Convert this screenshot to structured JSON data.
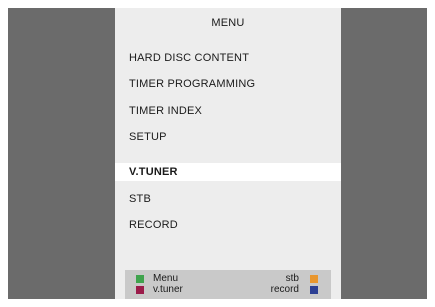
{
  "menu": {
    "title": "MENU",
    "items": [
      {
        "label": "HARD DISC CONTENT",
        "selected": false
      },
      {
        "label": "TIMER PROGRAMMING",
        "selected": false
      },
      {
        "label": "TIMER INDEX",
        "selected": false
      },
      {
        "label": "SETUP",
        "selected": false
      },
      {
        "label": "V.TUNER",
        "selected": true
      },
      {
        "label": "STB",
        "selected": false
      },
      {
        "label": "RECORD",
        "selected": false
      }
    ]
  },
  "footer": {
    "left": [
      {
        "label": "Menu",
        "color": "#3fa34d"
      },
      {
        "label": "v.tuner",
        "color": "#9b1b4a"
      }
    ],
    "right": [
      {
        "label": "stb",
        "color": "#e8962e"
      },
      {
        "label": "record",
        "color": "#2c3f93"
      }
    ]
  }
}
